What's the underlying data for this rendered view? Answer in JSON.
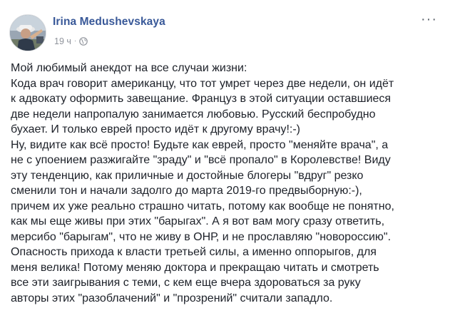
{
  "author": {
    "name": "Irina Medushevskaya",
    "timestamp": "19 ч",
    "separator": "·",
    "privacy_icon": "globe-icon"
  },
  "more_button": {
    "label": "···"
  },
  "post": {
    "lines": [
      "Мой любимый анекдот на все случаи жизни:",
      "Кода врач говорит американцу, что тот умрет через две недели, он идёт",
      "к адвокату оформить завещание. Француз в этой ситуации оставшиеся",
      "две недели напропалую занимается любовью. Русский беспробудно",
      "бухает. И только еврей просто идёт к другому врачу!:-)",
      "Ну, видите как всё просто! Будьте как еврей, просто \"меняйте врача\", а",
      "не с упоением разжигайте \"зраду\" и \"всё пропало\" в Королевстве! Виду",
      "эту тенденцию, как приличные и достойные блогеры \"вдруг\" резко",
      "сменили тон и начали задолго до марта 2019-го предвыборную:-),",
      "причем их уже реально страшно читать, потому как вообще не понятно,",
      "как мы еще живы при этих \"барыгах\". А я вот вам могу сразу ответить,",
      "мерсибо \"барыгам\", что не живу в ОНР, и не прославляю \"новороссию\".",
      "Опасность прихода к власти третьей силы, а именно оппорыгов, для",
      "меня велика! Потому меняю доктора и прекращаю читать и смотреть",
      "все эти заигрывания с теми, с кем еще вчера здороваться за руку",
      "авторы этих \"разоблачений\" и \"прозрений\" считали западло."
    ]
  },
  "colors": {
    "author_link": "#385898",
    "meta_text": "#90949c",
    "body_text": "#1d2129",
    "background": "#ffffff"
  }
}
